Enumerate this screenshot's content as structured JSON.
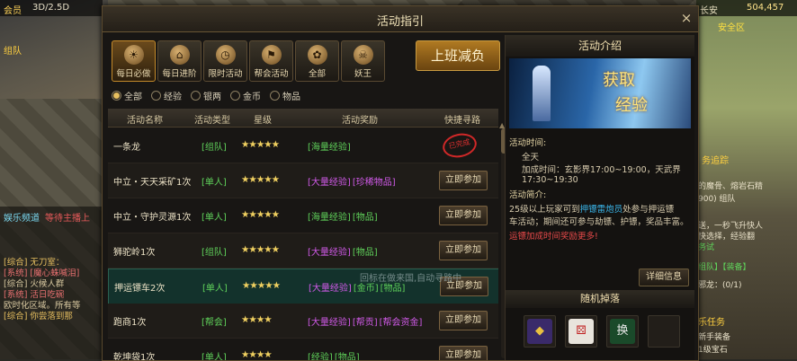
{
  "hud": {
    "vip_label": "会员",
    "mode_label": "3D/2.5D",
    "map_name": "长安",
    "currency": "504,457",
    "left_tags": [
      "组队",
      "娱乐频道",
      "等待主播上"
    ],
    "chat_lines": [
      "[综合] 无刀室：",
      "[系统] [魔心蛛喊泪]",
      "[综合] 火候人群",
      "[系统] 活日吃碗",
      "欧时化区域。所有等",
      "[综合] 你尝落到那"
    ],
    "right_tags": [
      "安全区",
      "的魔骨、熔岩石精",
      "900) 组队",
      "务追踪",
      "送，一秒飞升快人",
      "快选择，经验翻",
      "务试",
      "组队】【装备】",
      "邪龙：(0/1)",
      "乐任务",
      "新手装备",
      "1级宝石"
    ]
  },
  "window": {
    "title": "活动指引",
    "close_label": "×"
  },
  "categories": [
    {
      "label": "每日必做",
      "glyph": "☀",
      "active": true
    },
    {
      "label": "每日进阶",
      "glyph": "⌂"
    },
    {
      "label": "限时活动",
      "glyph": "◷"
    },
    {
      "label": "帮会活动",
      "glyph": "⚑"
    },
    {
      "label": "全部",
      "glyph": "✿"
    },
    {
      "label": "妖王",
      "glyph": "☠"
    }
  ],
  "big_button": "上班减负",
  "filters": [
    {
      "label": "全部",
      "on": true
    },
    {
      "label": "经验"
    },
    {
      "label": "银两"
    },
    {
      "label": "金币"
    },
    {
      "label": "物品"
    }
  ],
  "columns": [
    "活动名称",
    "活动类型",
    "星级",
    "活动奖励",
    "快捷寻路"
  ],
  "rows": [
    {
      "name": "一条龙",
      "type": "[组队]",
      "stars": "★★★★★",
      "rewards": [
        {
          "t": "[海量经验]",
          "c": "g"
        }
      ],
      "action": "已完成",
      "done": true
    },
    {
      "name": "中立・天天采矿1次",
      "type": "[单人]",
      "stars": "★★★★★",
      "rewards": [
        {
          "t": "[大量经验]",
          "c": "p"
        },
        {
          "t": "[珍稀物品]",
          "c": "p"
        }
      ],
      "action": "立即参加"
    },
    {
      "name": "中立・守护灵源1次",
      "type": "[单人]",
      "stars": "★★★★★",
      "rewards": [
        {
          "t": "[海量经验]",
          "c": "g"
        },
        {
          "t": "[物品]",
          "c": "g"
        }
      ],
      "action": "立即参加"
    },
    {
      "name": "狮驼岭1次",
      "type": "[组队]",
      "stars": "★★★★★",
      "rewards": [
        {
          "t": "[大量经验]",
          "c": "p"
        },
        {
          "t": "[物品]",
          "c": "g"
        }
      ],
      "action": "立即参加"
    },
    {
      "name": "押运镖车2次",
      "type": "[单人]",
      "stars": "★★★★★",
      "rewards": [
        {
          "t": "[大量经验]",
          "c": "p"
        },
        {
          "t": "[金币]",
          "c": "g"
        },
        {
          "t": "[物品]",
          "c": "g"
        }
      ],
      "action": "立即参加",
      "selected": true
    },
    {
      "name": "跑商1次",
      "type": "[帮会]",
      "stars": "★★★★",
      "rewards": [
        {
          "t": "[大量经验]",
          "c": "p"
        },
        {
          "t": "[帮贡]",
          "c": "p"
        },
        {
          "t": "[帮会资金]",
          "c": "p"
        }
      ],
      "action": "立即参加"
    },
    {
      "name": "乾坤袋1次",
      "type": "[单人]",
      "stars": "★★★★",
      "rewards": [
        {
          "t": "[经验]",
          "c": "g"
        },
        {
          "t": "[物品]",
          "c": "g"
        }
      ],
      "action": "立即参加"
    }
  ],
  "ghost_text": "回标在做来国,自动寻路中",
  "detail": {
    "header": "活动介绍",
    "banner_line1": "获取",
    "banner_line2": "经验",
    "lines": [
      {
        "text": "活动时间:",
        "cls": "hd"
      },
      {
        "text": "全天"
      },
      {
        "text": "加成时间：玄影界17:00~19:00，天武界17:30~19:30"
      },
      {
        "text": "活动简介:",
        "cls": "hd"
      },
      {
        "pre": "25级以上玩家可到",
        "link": "押镖雷炮员",
        "post": "处参与押运镖"
      },
      {
        "text": "车活动；期间还可参与劫镖、护镖，奖品丰富。"
      },
      {
        "text": "运镖加成时间奖励更多!",
        "cls": "red"
      }
    ],
    "detail_button": "详细信息",
    "drop_header": "随机掉落",
    "drops": [
      {
        "glyph": "◆",
        "color": "#e8c040",
        "bg": "#3a2a6a"
      },
      {
        "glyph": "⚄",
        "color": "#c02020",
        "bg": "#e8e4dc"
      },
      {
        "glyph": "换",
        "color": "#e8e8e8",
        "bg": "#1a4a2a"
      },
      {
        "glyph": "",
        "color": "#000",
        "bg": "transparent"
      }
    ]
  }
}
